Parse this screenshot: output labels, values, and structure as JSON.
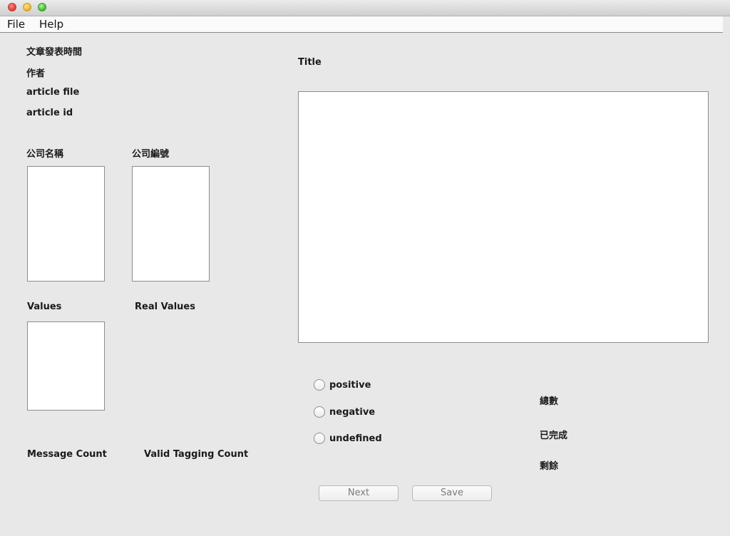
{
  "menu": {
    "file": "File",
    "help": "Help"
  },
  "article": {
    "publish_time_label": "文章發表時間",
    "author_label": "作者",
    "file_label": "article file",
    "id_label": "article id",
    "title_label": "Title"
  },
  "company": {
    "name_label": "公司名稱",
    "code_label": "公司編號"
  },
  "values": {
    "values_label": "Values",
    "real_values_label": "Real Values"
  },
  "counts": {
    "message_count_label": "Message Count",
    "valid_tagging_count_label": "Valid Tagging Count"
  },
  "sentiment": {
    "options": [
      "positive",
      "negative",
      "undefined"
    ],
    "selected": null
  },
  "progress": {
    "total_label": "總數",
    "done_label": "已完成",
    "remaining_label": "剩餘"
  },
  "buttons": {
    "next": "Next",
    "save": "Save"
  }
}
